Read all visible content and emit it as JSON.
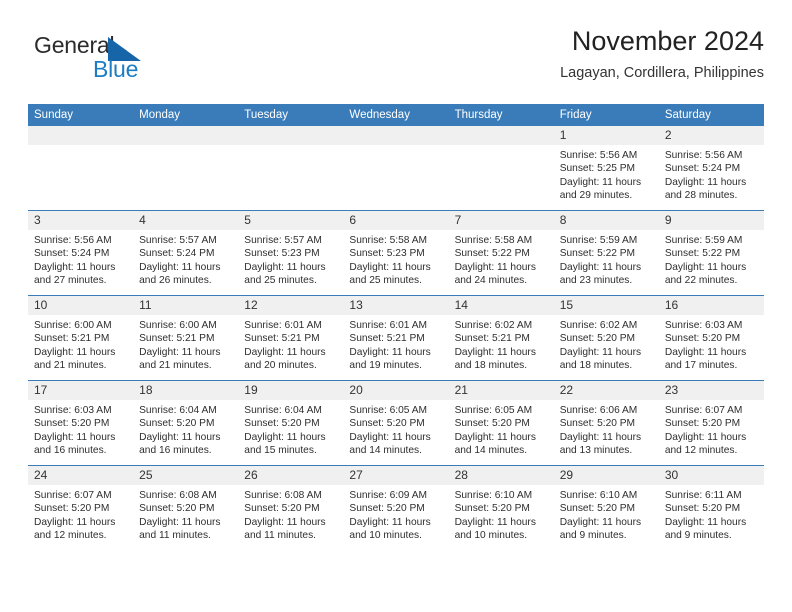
{
  "brand": {
    "name_part1": "General",
    "name_part2": "Blue",
    "accent_color": "#1d7dc4",
    "triangle_color": "#1565a8"
  },
  "header": {
    "title": "November 2024",
    "subtitle": "Lagayan, Cordillera, Philippines"
  },
  "calendar": {
    "header_color": "#3a7cb9",
    "daynum_band_color": "#f0f0f0",
    "weekday_headers": [
      "Sunday",
      "Monday",
      "Tuesday",
      "Wednesday",
      "Thursday",
      "Friday",
      "Saturday"
    ],
    "weeks": [
      [
        {
          "day": "",
          "lines": []
        },
        {
          "day": "",
          "lines": []
        },
        {
          "day": "",
          "lines": []
        },
        {
          "day": "",
          "lines": []
        },
        {
          "day": "",
          "lines": []
        },
        {
          "day": "1",
          "lines": [
            "Sunrise: 5:56 AM",
            "Sunset: 5:25 PM",
            "Daylight: 11 hours",
            "and 29 minutes."
          ]
        },
        {
          "day": "2",
          "lines": [
            "Sunrise: 5:56 AM",
            "Sunset: 5:24 PM",
            "Daylight: 11 hours",
            "and 28 minutes."
          ]
        }
      ],
      [
        {
          "day": "3",
          "lines": [
            "Sunrise: 5:56 AM",
            "Sunset: 5:24 PM",
            "Daylight: 11 hours",
            "and 27 minutes."
          ]
        },
        {
          "day": "4",
          "lines": [
            "Sunrise: 5:57 AM",
            "Sunset: 5:24 PM",
            "Daylight: 11 hours",
            "and 26 minutes."
          ]
        },
        {
          "day": "5",
          "lines": [
            "Sunrise: 5:57 AM",
            "Sunset: 5:23 PM",
            "Daylight: 11 hours",
            "and 25 minutes."
          ]
        },
        {
          "day": "6",
          "lines": [
            "Sunrise: 5:58 AM",
            "Sunset: 5:23 PM",
            "Daylight: 11 hours",
            "and 25 minutes."
          ]
        },
        {
          "day": "7",
          "lines": [
            "Sunrise: 5:58 AM",
            "Sunset: 5:22 PM",
            "Daylight: 11 hours",
            "and 24 minutes."
          ]
        },
        {
          "day": "8",
          "lines": [
            "Sunrise: 5:59 AM",
            "Sunset: 5:22 PM",
            "Daylight: 11 hours",
            "and 23 minutes."
          ]
        },
        {
          "day": "9",
          "lines": [
            "Sunrise: 5:59 AM",
            "Sunset: 5:22 PM",
            "Daylight: 11 hours",
            "and 22 minutes."
          ]
        }
      ],
      [
        {
          "day": "10",
          "lines": [
            "Sunrise: 6:00 AM",
            "Sunset: 5:21 PM",
            "Daylight: 11 hours",
            "and 21 minutes."
          ]
        },
        {
          "day": "11",
          "lines": [
            "Sunrise: 6:00 AM",
            "Sunset: 5:21 PM",
            "Daylight: 11 hours",
            "and 21 minutes."
          ]
        },
        {
          "day": "12",
          "lines": [
            "Sunrise: 6:01 AM",
            "Sunset: 5:21 PM",
            "Daylight: 11 hours",
            "and 20 minutes."
          ]
        },
        {
          "day": "13",
          "lines": [
            "Sunrise: 6:01 AM",
            "Sunset: 5:21 PM",
            "Daylight: 11 hours",
            "and 19 minutes."
          ]
        },
        {
          "day": "14",
          "lines": [
            "Sunrise: 6:02 AM",
            "Sunset: 5:21 PM",
            "Daylight: 11 hours",
            "and 18 minutes."
          ]
        },
        {
          "day": "15",
          "lines": [
            "Sunrise: 6:02 AM",
            "Sunset: 5:20 PM",
            "Daylight: 11 hours",
            "and 18 minutes."
          ]
        },
        {
          "day": "16",
          "lines": [
            "Sunrise: 6:03 AM",
            "Sunset: 5:20 PM",
            "Daylight: 11 hours",
            "and 17 minutes."
          ]
        }
      ],
      [
        {
          "day": "17",
          "lines": [
            "Sunrise: 6:03 AM",
            "Sunset: 5:20 PM",
            "Daylight: 11 hours",
            "and 16 minutes."
          ]
        },
        {
          "day": "18",
          "lines": [
            "Sunrise: 6:04 AM",
            "Sunset: 5:20 PM",
            "Daylight: 11 hours",
            "and 16 minutes."
          ]
        },
        {
          "day": "19",
          "lines": [
            "Sunrise: 6:04 AM",
            "Sunset: 5:20 PM",
            "Daylight: 11 hours",
            "and 15 minutes."
          ]
        },
        {
          "day": "20",
          "lines": [
            "Sunrise: 6:05 AM",
            "Sunset: 5:20 PM",
            "Daylight: 11 hours",
            "and 14 minutes."
          ]
        },
        {
          "day": "21",
          "lines": [
            "Sunrise: 6:05 AM",
            "Sunset: 5:20 PM",
            "Daylight: 11 hours",
            "and 14 minutes."
          ]
        },
        {
          "day": "22",
          "lines": [
            "Sunrise: 6:06 AM",
            "Sunset: 5:20 PM",
            "Daylight: 11 hours",
            "and 13 minutes."
          ]
        },
        {
          "day": "23",
          "lines": [
            "Sunrise: 6:07 AM",
            "Sunset: 5:20 PM",
            "Daylight: 11 hours",
            "and 12 minutes."
          ]
        }
      ],
      [
        {
          "day": "24",
          "lines": [
            "Sunrise: 6:07 AM",
            "Sunset: 5:20 PM",
            "Daylight: 11 hours",
            "and 12 minutes."
          ]
        },
        {
          "day": "25",
          "lines": [
            "Sunrise: 6:08 AM",
            "Sunset: 5:20 PM",
            "Daylight: 11 hours",
            "and 11 minutes."
          ]
        },
        {
          "day": "26",
          "lines": [
            "Sunrise: 6:08 AM",
            "Sunset: 5:20 PM",
            "Daylight: 11 hours",
            "and 11 minutes."
          ]
        },
        {
          "day": "27",
          "lines": [
            "Sunrise: 6:09 AM",
            "Sunset: 5:20 PM",
            "Daylight: 11 hours",
            "and 10 minutes."
          ]
        },
        {
          "day": "28",
          "lines": [
            "Sunrise: 6:10 AM",
            "Sunset: 5:20 PM",
            "Daylight: 11 hours",
            "and 10 minutes."
          ]
        },
        {
          "day": "29",
          "lines": [
            "Sunrise: 6:10 AM",
            "Sunset: 5:20 PM",
            "Daylight: 11 hours",
            "and 9 minutes."
          ]
        },
        {
          "day": "30",
          "lines": [
            "Sunrise: 6:11 AM",
            "Sunset: 5:20 PM",
            "Daylight: 11 hours",
            "and 9 minutes."
          ]
        }
      ]
    ]
  }
}
